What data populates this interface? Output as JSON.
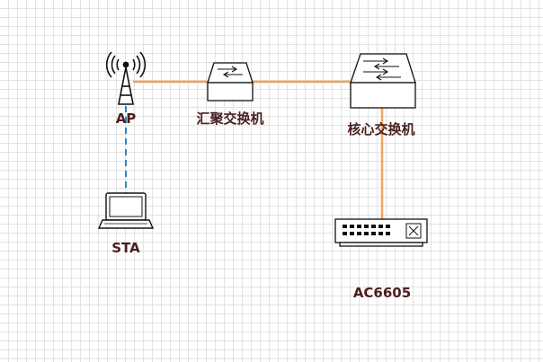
{
  "colors": {
    "link": "#f0a35c",
    "wireless": "#2e86c9",
    "label": "#4a1f1f",
    "device_stroke": "#111111",
    "grid": "#e2e2e2"
  },
  "nodes": {
    "ap": {
      "label": "AP",
      "icon": "wireless-ap-icon"
    },
    "aggregation_switch": {
      "label": "汇聚交换机",
      "icon": "switch-icon"
    },
    "core_switch": {
      "label": "核心交换机",
      "icon": "switch-icon"
    },
    "sta": {
      "label": "STA",
      "icon": "laptop-icon"
    },
    "ac": {
      "label": "AC6605",
      "icon": "access-controller-icon"
    }
  },
  "links": [
    {
      "from": "ap",
      "to": "aggregation_switch",
      "type": "wired"
    },
    {
      "from": "aggregation_switch",
      "to": "core_switch",
      "type": "wired"
    },
    {
      "from": "core_switch",
      "to": "ac",
      "type": "wired"
    },
    {
      "from": "ap",
      "to": "sta",
      "type": "wireless"
    }
  ]
}
